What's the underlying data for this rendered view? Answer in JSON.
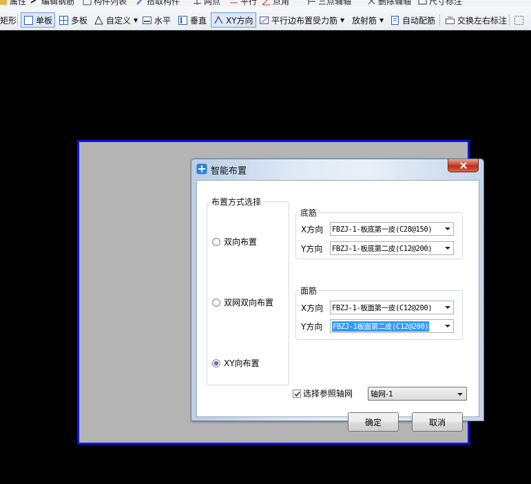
{
  "toolbar_top": {
    "items": [
      "属性",
      "编辑钢筋",
      "构件列表",
      "拾取构件",
      "两点",
      "平行",
      "点角",
      "三点辅轴",
      "删除辅轴",
      "尺寸标注"
    ]
  },
  "toolbar": {
    "cut_label": "矩形",
    "single_slab": "单板",
    "multi_slab": "多板",
    "custom": "自定义",
    "horizontal": "水平",
    "vertical": "垂直",
    "xy_direction": "XY方向",
    "parallel_edge": "平行边布置受力筋",
    "radial": "放射筋",
    "auto_rebar": "自动配筋",
    "swap_label": "交换左右标注"
  },
  "dialog": {
    "title": "智能布置",
    "layout_group": "布置方式选择",
    "options": [
      "双向布置",
      "双网双向布置",
      "XY向布置"
    ],
    "bottom_group": "底筋",
    "top_group": "面筋",
    "x_label": "X方向",
    "y_label": "Y方向",
    "bottom_x": "FBZJ-1-板底第一皮(C28@150)",
    "bottom_y": "FBZJ-1-板底第二皮(C12@200)",
    "top_x": "FBZJ-1-板面第一皮(C12@200)",
    "top_y": "FBZJ-1板面第二皮(C12@200)",
    "ref_axis_label": "选择参照轴网",
    "ref_axis_value": "轴网-1",
    "ok": "确定",
    "cancel": "取消"
  },
  "colors": {
    "canvas_bg": "#000000",
    "slab_fill": "#b4b4b4",
    "slab_border": "#0a14e8",
    "selection": "#3399ff"
  }
}
